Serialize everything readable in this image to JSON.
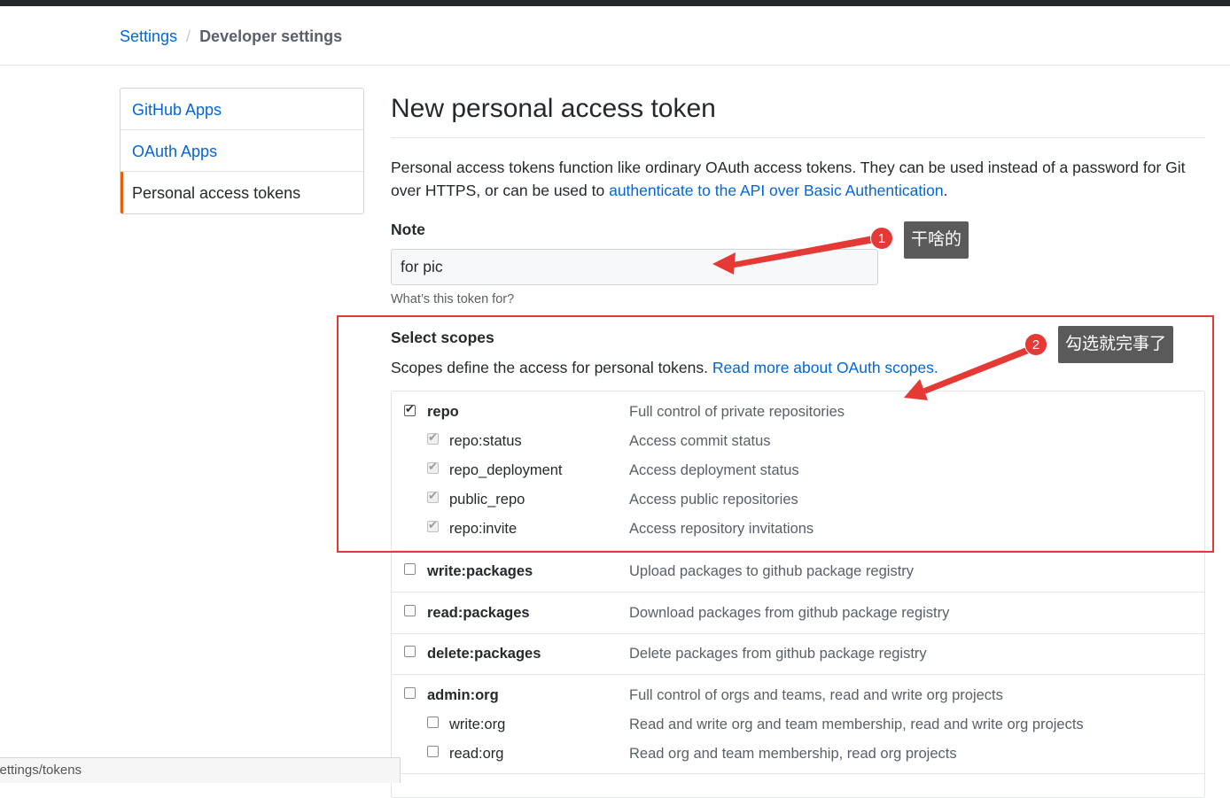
{
  "breadcrumb": {
    "root": "Settings",
    "separator": "/",
    "current": "Developer settings"
  },
  "sidebar": {
    "items": [
      {
        "label": "GitHub Apps",
        "selected": false
      },
      {
        "label": "OAuth Apps",
        "selected": false
      },
      {
        "label": "Personal access tokens",
        "selected": true
      }
    ]
  },
  "main": {
    "title": "New personal access token",
    "intro_text": "Personal access tokens function like ordinary OAuth access tokens. They can be used instead of a password for Git over HTTPS, or can be used to ",
    "intro_link": "authenticate to the API over Basic Authentication",
    "intro_end": ".",
    "note_label": "Note",
    "note_value": "for pic",
    "note_hint": "What’s this token for?",
    "scopes_label": "Select scopes",
    "scopes_desc": "Scopes define the access for personal tokens. ",
    "scopes_link": "Read more about OAuth scopes."
  },
  "scopes": [
    {
      "name": "repo",
      "desc": "Full control of private repositories",
      "checked": true,
      "children": [
        {
          "name": "repo:status",
          "desc": "Access commit status",
          "checked": true
        },
        {
          "name": "repo_deployment",
          "desc": "Access deployment status",
          "checked": true
        },
        {
          "name": "public_repo",
          "desc": "Access public repositories",
          "checked": true
        },
        {
          "name": "repo:invite",
          "desc": "Access repository invitations",
          "checked": true
        }
      ]
    },
    {
      "name": "write:packages",
      "desc": "Upload packages to github package registry",
      "checked": false,
      "children": []
    },
    {
      "name": "read:packages",
      "desc": "Download packages from github package registry",
      "checked": false,
      "children": []
    },
    {
      "name": "delete:packages",
      "desc": "Delete packages from github package registry",
      "checked": false,
      "children": []
    },
    {
      "name": "admin:org",
      "desc": "Full control of orgs and teams, read and write org projects",
      "checked": false,
      "children": [
        {
          "name": "write:org",
          "desc": "Read and write org and team membership, read and write org projects",
          "checked": false
        },
        {
          "name": "read:org",
          "desc": "Read org and team membership, read org projects",
          "checked": false
        }
      ]
    }
  ],
  "annotations": {
    "badge1": "1",
    "tip1": "干啥的",
    "badge2": "2",
    "tip2": "勾选就完事了",
    "color": "#e53935"
  },
  "statusbar": {
    "url": "settings/tokens"
  }
}
